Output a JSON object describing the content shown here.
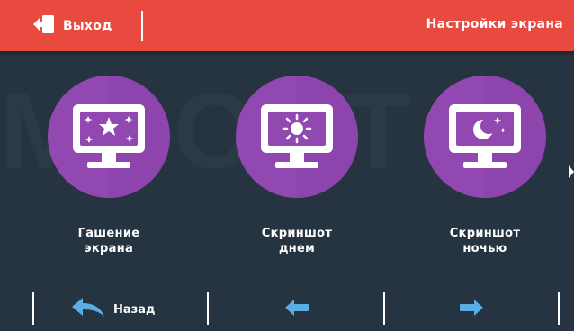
{
  "header": {
    "exit_label": "Выход",
    "title": "Настройки экрана",
    "bar_color": "#e84a3f"
  },
  "background_color": "#263340",
  "watermark_text": "MPORT",
  "tiles": [
    {
      "line1": "Гашение",
      "line2": "экрана",
      "icon": "monitor-stars-icon"
    },
    {
      "line1": "Скриншот",
      "line2": "днем",
      "icon": "monitor-sun-icon"
    },
    {
      "line1": "Скриншот",
      "line2": "ночью",
      "icon": "monitor-moon-icon"
    }
  ],
  "accent_color": "#9148b0",
  "arrow_color": "#5aaee6",
  "footer": {
    "back_label": "Назад"
  }
}
